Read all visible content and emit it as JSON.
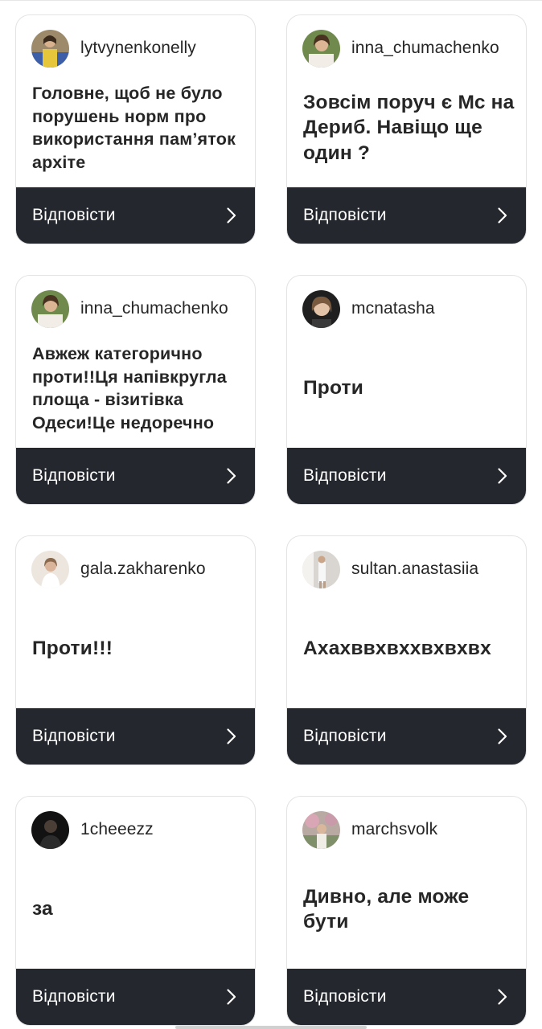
{
  "reply_label": "Відповісти",
  "colors": {
    "card_border": "#e3e3e3",
    "footer_bg": "#24272d",
    "text": "#262626",
    "reply_text": "#ffffff"
  },
  "cards": [
    {
      "username": "lytvynenkonelly",
      "question": "Головне, щоб не було порушень норм про використання пам’яток архіте",
      "avatar": "avatar-photo-yellow-blue"
    },
    {
      "username": "inna_chumachenko",
      "question": "Зовсім поруч є Мс на Дериб. Навіщо ще один ?",
      "avatar": "avatar-photo-green"
    },
    {
      "username": "inna_chumachenko",
      "question": "Авжеж категорично проти!!Ця напівкругла площа - візитівка Одеси!Це недоречно",
      "avatar": "avatar-photo-green"
    },
    {
      "username": "mcnatasha",
      "question": "Проти",
      "avatar": "avatar-photo-dark"
    },
    {
      "username": "gala.zakharenko",
      "question": "Проти!!!",
      "avatar": "avatar-photo-light"
    },
    {
      "username": "sultan.anastasiia",
      "question": "Ахахввхвххвхвхвх",
      "avatar": "avatar-photo-grey"
    },
    {
      "username": "1cheeezz",
      "question": "за",
      "avatar": "avatar-photo-black"
    },
    {
      "username": "marchsvolk",
      "question": "Дивно, але може бути",
      "avatar": "avatar-photo-pink"
    }
  ]
}
